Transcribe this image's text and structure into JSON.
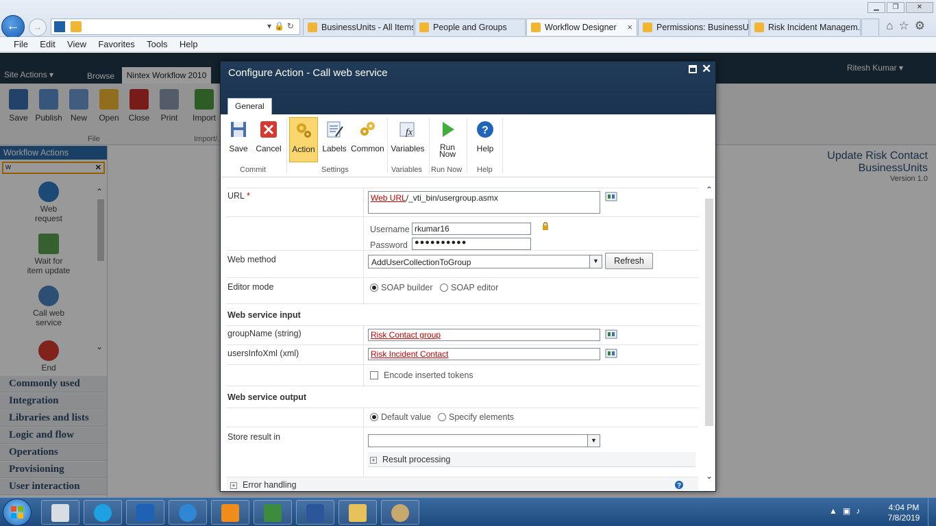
{
  "browser": {
    "tabs": [
      {
        "label": "BusinessUnits - All Items"
      },
      {
        "label": "People and Groups"
      },
      {
        "label": "Workflow Designer"
      },
      {
        "label": "Permissions: BusinessU..."
      },
      {
        "label": "Risk Incident Managem..."
      }
    ],
    "tab_close_glyph": "×",
    "menu": [
      "File",
      "Edit",
      "View",
      "Favorites",
      "Tools",
      "Help"
    ]
  },
  "sharepoint": {
    "site_actions": "Site Actions ▾",
    "browse_tab": "Browse",
    "nintex_tab": "Nintex Workflow 2010",
    "user": "Ritesh Kumar ▾",
    "ribbon": [
      {
        "label": "Save",
        "color": "#3b6fb0"
      },
      {
        "label": "Publish",
        "color": "#5d8fce"
      },
      {
        "label": "New",
        "color": "#6d9ad4"
      },
      {
        "label": "Open",
        "color": "#f2b632"
      },
      {
        "label": "Close",
        "color": "#c9302c"
      },
      {
        "label": "Print",
        "color": "#8a9aae"
      },
      {
        "label": "Import",
        "color": "#4c9a3c"
      }
    ],
    "ribbon_groups": [
      "File",
      "Import/..."
    ],
    "actions_panel_title": "Workflow Actions",
    "actions_search_value": "w",
    "actions": [
      {
        "label": "Web\nrequest",
        "color": "#2f7bc4"
      },
      {
        "label": "Wait for\nitem update",
        "color": "#5aa050"
      },
      {
        "label": "Call web\nservice",
        "color": "#4a84c0"
      },
      {
        "label": "End",
        "color": "#d63b2f"
      }
    ],
    "categories": [
      "Commonly used",
      "Integration",
      "Libraries and lists",
      "Logic and flow",
      "Operations",
      "Provisioning",
      "User interaction"
    ],
    "right_title_1": "Update Risk Contact",
    "right_title_2": "BusinessUnits",
    "right_version": "Version 1.0"
  },
  "dialog": {
    "title": "Configure Action - Call web service",
    "tab_general": "General",
    "buttons": [
      {
        "label": "Save",
        "group": "Commit"
      },
      {
        "label": "Cancel",
        "group": "Commit"
      },
      {
        "label": "Action",
        "group": "Settings"
      },
      {
        "label": "Labels",
        "group": "Settings"
      },
      {
        "label": "Common",
        "group": "Settings"
      },
      {
        "label": "Variables",
        "group": "Variables"
      },
      {
        "label": "Run Now",
        "group": "Run Now"
      },
      {
        "label": "Help",
        "group": "Help"
      }
    ],
    "groups": [
      "Commit",
      "Settings",
      "Variables",
      "Run Now",
      "Help"
    ],
    "url_label": "URL",
    "required_marker": "*",
    "url_token": "Web URL",
    "url_suffix": "/_vti_bin/usergroup.asmx",
    "username_label": "Username",
    "username_value": "rkumar16",
    "password_label": "Password",
    "password_mask": "●●●●●●●●●●",
    "web_method_label": "Web method",
    "web_method_value": "AddUserCollectionToGroup",
    "refresh_label": "Refresh",
    "editor_mode_label": "Editor mode",
    "editor_option_builder": "SOAP builder",
    "editor_option_editor": "SOAP editor",
    "input_section": "Web service input",
    "param1_label": "groupName (string)",
    "param1_value": "Risk Contact group",
    "param2_label": "usersInfoXml (xml)",
    "param2_value": "Risk Incident Contact",
    "encode_label": "Encode inserted tokens",
    "output_section": "Web service output",
    "output_option_default": "Default value",
    "output_option_specify": "Specify elements",
    "store_result_label": "Store result in",
    "store_result_value": "",
    "result_processing_label": "Result processing",
    "error_handling_label": "Error handling"
  },
  "taskbar": {
    "apps": [
      {
        "name": "explorer-window",
        "color": "#d8dde4"
      },
      {
        "name": "skype",
        "color": "#1da1e2"
      },
      {
        "name": "outlook",
        "color": "#1f62b5"
      },
      {
        "name": "internet-explorer",
        "color": "#2f87d4"
      },
      {
        "name": "snipping-tool",
        "color": "#f08c1a"
      },
      {
        "name": "project",
        "color": "#3d8b3d"
      },
      {
        "name": "word",
        "color": "#2b579a"
      },
      {
        "name": "file-explorer",
        "color": "#e7c25b"
      },
      {
        "name": "paint",
        "color": "#c7a86d"
      }
    ],
    "time": "4:04 PM",
    "date": "7/8/2019"
  }
}
